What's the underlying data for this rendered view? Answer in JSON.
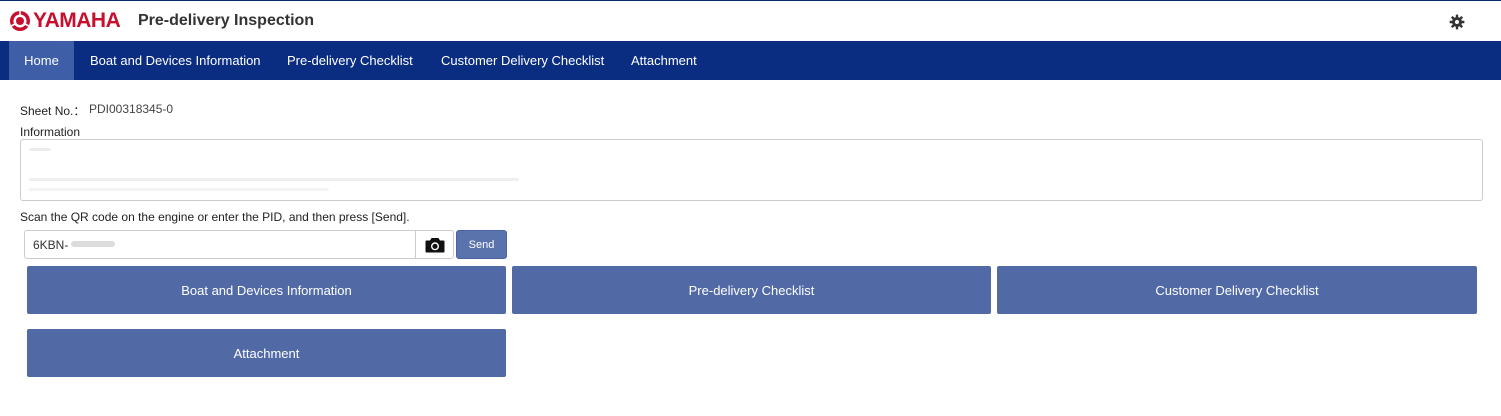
{
  "header": {
    "logo_text": "YAMAHA",
    "title": "Pre-delivery Inspection",
    "settings_icon": "gear-icon"
  },
  "nav": {
    "tabs": [
      {
        "label": "Home",
        "active": true
      },
      {
        "label": "Boat and Devices Information",
        "active": false
      },
      {
        "label": "Pre-delivery Checklist",
        "active": false
      },
      {
        "label": "Customer Delivery Checklist",
        "active": false
      },
      {
        "label": "Attachment",
        "active": false
      }
    ]
  },
  "sheet": {
    "label": "Sheet No.：",
    "value": "PDI00318345-0"
  },
  "information": {
    "label": "Information"
  },
  "scan": {
    "instruction": "Scan the QR code on the engine or enter the PID, and then press [Send].",
    "pid_value": "6KBN-",
    "camera_icon": "camera-icon",
    "send_label": "Send"
  },
  "actions": {
    "boat_devices": "Boat and Devices Information",
    "predelivery": "Pre-delivery Checklist",
    "customer_delivery": "Customer Delivery Checklist",
    "attachment": "Attachment"
  },
  "colors": {
    "brand_red": "#c8102e",
    "navbar": "#0a2d82",
    "nav_active": "#3e5fa8",
    "button": "#516aa6"
  }
}
